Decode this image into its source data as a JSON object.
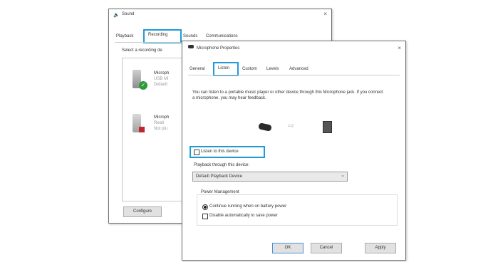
{
  "sound_window": {
    "title": "Sound",
    "close": "×",
    "tabs": [
      "Playback",
      "Recording",
      "Sounds",
      "Communications"
    ],
    "active_tab": "Recording",
    "instruction": "Select a recording de",
    "devices": [
      {
        "name": "Microph",
        "line2": "USB Mi",
        "line3": "Default",
        "status": "check"
      },
      {
        "name": "Microph",
        "line2": "Realt",
        "line3": "Not plu",
        "status": "unplugged"
      }
    ],
    "configure_button": "Configure"
  },
  "props_window": {
    "title": "Microphone Properties",
    "close": "×",
    "tabs": [
      "General",
      "Listen",
      "Custom",
      "Levels",
      "Advanced"
    ],
    "active_tab": "Listen",
    "description": "You can listen to a portable music player or other device through this Microphone jack. If you connect a microphone, you may hear feedback.",
    "listen_checkbox_label": "Listen to this device",
    "listen_checked": false,
    "playback_label": "Playback through this device:",
    "playback_value": "Default Playback Device",
    "power_group_label": "Power Management",
    "power_options": [
      {
        "label": "Continue running when on battery power",
        "selected": true
      },
      {
        "label": "Disable automatically to save power",
        "selected": false
      }
    ],
    "buttons": {
      "ok": "OK",
      "cancel": "Cancel",
      "apply": "Apply"
    }
  },
  "colors": {
    "highlight": "#1f9bd8",
    "accent_green": "#2e9b3a"
  }
}
